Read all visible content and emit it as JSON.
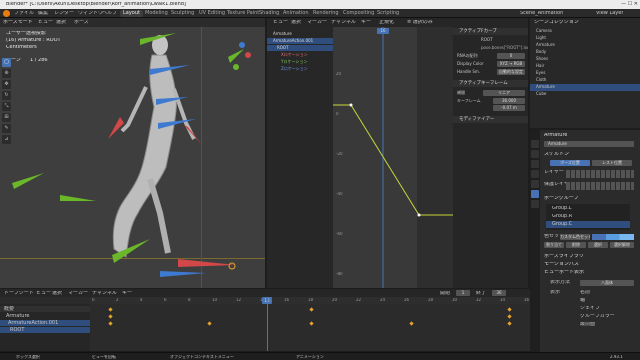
{
  "window": {
    "title": "Blender* [C:\\Users\\Akun\\Desktop\\Blender\\Rorf_animation\\Lwalk1.blend]",
    "controls": "— ☐ ✕"
  },
  "menu": {
    "items": [
      "ファイル",
      "編集",
      "レンダー",
      "ウィンドウ",
      "ヘルプ"
    ]
  },
  "workspaces": {
    "items": [
      "Layout",
      "Modeling",
      "Sculpting",
      "UV Editing",
      "Texture Paint",
      "Shading",
      "Animation",
      "Rendering",
      "Compositing",
      "Scripting"
    ],
    "active": "Layout"
  },
  "scene": {
    "name": "Scene_Animation",
    "view_layer": "View Layer"
  },
  "viewport": {
    "mode": "ポーズモード",
    "view_label": "ビュー",
    "select_label": "選択",
    "pose_label": "ポーズ",
    "info_line1": "ユーザー透視投影",
    "info_line2": "(16) Armature : ROOT",
    "info_line3": "Centimeters",
    "bone_label": "ボーン",
    "bone_value": "1 / 286"
  },
  "graph": {
    "header_items": [
      "ビュー",
      "選択",
      "マーカー",
      "チャンネル",
      "キー"
    ],
    "normalize": "正規化",
    "filter": "≡ 選択のみ",
    "channels": [
      {
        "label": "Armature",
        "sel": false
      },
      {
        "label": "ArmatureAction.001",
        "sel": true
      },
      {
        "label": "ROOT",
        "sel": true
      },
      {
        "label": "Xロケーション",
        "sel": false
      },
      {
        "label": "Yロケーション",
        "sel": false
      },
      {
        "label": "Zロケーション",
        "sel": false
      }
    ],
    "y_ticks": [
      "20",
      "0",
      "-20",
      "-40",
      "-60",
      "-80"
    ],
    "current_frame": "16"
  },
  "fcurve_panel": {
    "title": "アクティブFカーブ",
    "bone": "ROOT",
    "data_path": "pose.bones[\"ROOT\"].location",
    "array_index_label": "RNAの配列",
    "array_index": "0",
    "color_mode_label": "Display Color",
    "color_mode": "XYZ → RGB",
    "handle_label": "Handle Sm.",
    "handle_value": "自動的な設定",
    "keyframe_title": "アクティブキーフレーム",
    "interp_label": "補間",
    "interp_value": "リニア",
    "frame_label": "キーフレーム",
    "frame_value": "36.000",
    "value_value": "-0.07 m",
    "modifiers_title": "モディファイアー"
  },
  "outliner": {
    "title": "シーンコレクション",
    "rows": [
      "Camera",
      "Light",
      "Armature",
      "Body",
      "Shoes",
      "Hair",
      "Eyes",
      "Cloth",
      "Armature",
      "Cube"
    ]
  },
  "properties": {
    "object": "Armature",
    "data": "Armature",
    "skeleton_label": "スケルトン",
    "pose_pos": "ポーズ位置",
    "rest_pos": "レスト位置",
    "layers_label": "レイヤー",
    "protected_label": "保護レイヤー",
    "bone_groups_title": "ボーングループ",
    "groups": [
      "Group.L",
      "Group.R",
      "Group.C"
    ],
    "assign_label": "割り当て",
    "remove_label": "削除",
    "select_label": "選択",
    "deselect_label": "選択解除",
    "color_set_label": "色セット",
    "color_set_value": "カスタム色セット",
    "pose_library": "ポーズライブラリ",
    "motion_paths": "モーションパス",
    "viewport_display": "ビューポート表示",
    "display_as_label": "表示方法",
    "display_as_value": "八面体",
    "show_label": "表示",
    "names": "名前",
    "axes": "軸",
    "shapes": "シェイプ",
    "group_colors": "グループカラー",
    "in_front": "最前面"
  },
  "dopesheet": {
    "mode": "ドープシート",
    "header_items": [
      "ビュー",
      "選択",
      "マーカー",
      "チャンネル",
      "キー"
    ],
    "summary": "概要",
    "channels": [
      "Armature",
      "ArmatureAction.001",
      "ROOT"
    ],
    "ticks": [
      "0",
      "2",
      "4",
      "6",
      "8",
      "10",
      "12",
      "14",
      "16",
      "18",
      "20",
      "22",
      "24",
      "26",
      "28",
      "30",
      "32",
      "34",
      "36"
    ],
    "current": "16",
    "start_label": "開始",
    "start_value": "1",
    "end_label": "終了",
    "end_value": "36"
  },
  "status": {
    "left": "ボックス選択",
    "middle": "ビューを回転",
    "right": "オブジェクトコンテキストメニュー",
    "anim": "アニメーション",
    "version": "2.93.1"
  },
  "colors": {
    "accent": "#4772b3",
    "keyframe": "#e8a32a",
    "curve": "#c8d63a",
    "x_axis": "#d24747",
    "y_axis": "#6ab72a",
    "z_axis": "#3f7ad1"
  }
}
